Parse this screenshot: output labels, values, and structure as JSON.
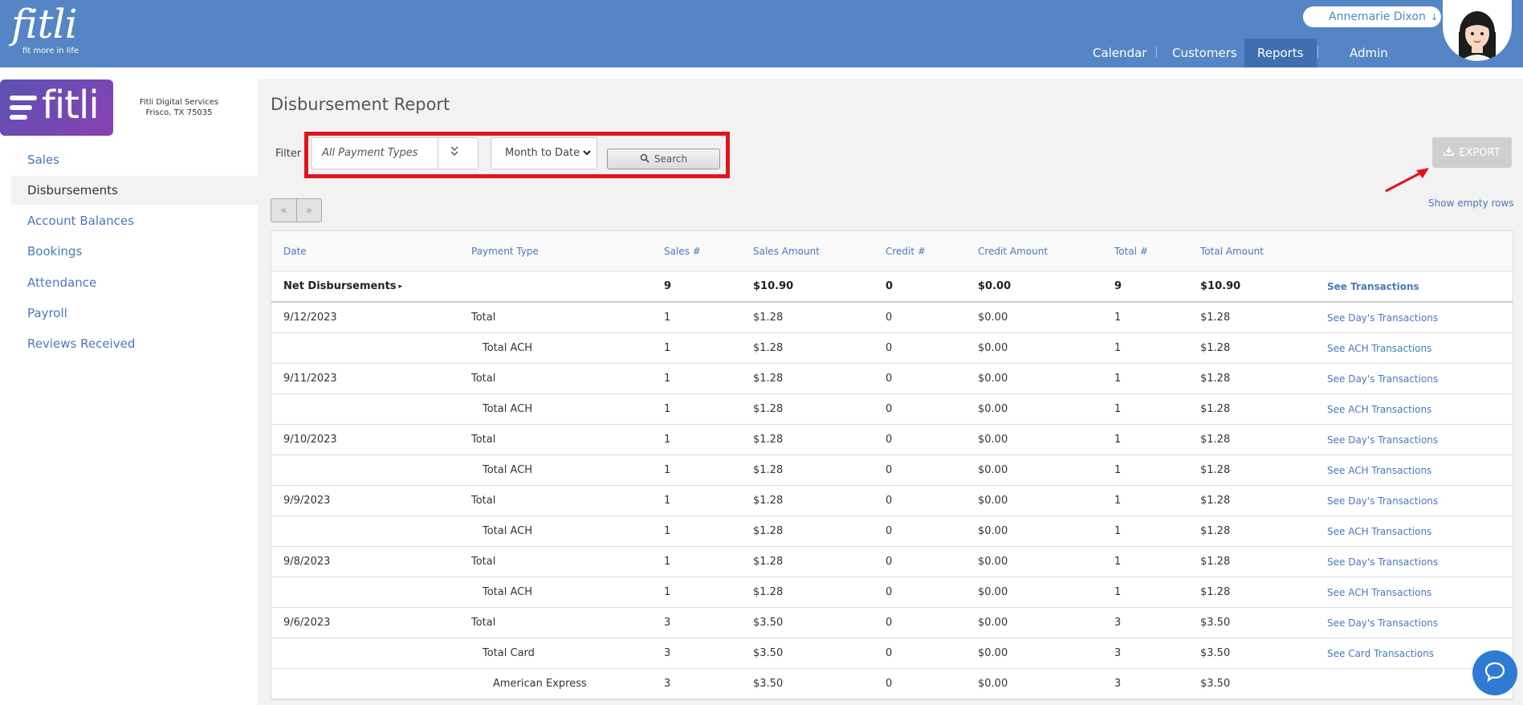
{
  "header": {
    "logo_word": "fitli",
    "logo_tagline": "fit more in life",
    "user_name": "Annemarie Dixon",
    "nav": [
      "Calendar",
      "Customers",
      "Reports",
      "Admin"
    ],
    "active_nav": "Reports"
  },
  "sidebar": {
    "brand_word": "fitli",
    "business_name": "Fitli Digital Services",
    "business_location": "Frisco, TX 75035",
    "items": [
      "Sales",
      "Disbursements",
      "Account Balances",
      "Bookings",
      "Attendance",
      "Payroll",
      "Reviews Received"
    ],
    "active_item": "Disbursements"
  },
  "main": {
    "title": "Disbursement Report",
    "filter_label": "Filter",
    "payment_type_value": "All Payment Types",
    "period_value": "Month to Date",
    "search_label": "Search",
    "export_label": "EXPORT",
    "pager_prev": "«",
    "pager_next": "»",
    "show_empty_rows": "Show empty rows"
  },
  "table": {
    "columns": [
      "Date",
      "Payment Type",
      "Sales #",
      "Sales Amount",
      "Credit #",
      "Credit Amount",
      "Total #",
      "Total Amount"
    ],
    "net": {
      "label": "Net Disbursements",
      "sales_count": "9",
      "sales_amount": "$10.90",
      "credit_count": "0",
      "credit_amount": "$0.00",
      "total_count": "9",
      "total_amount": "$10.90",
      "link": "See Transactions"
    },
    "rows": [
      {
        "date": "9/12/2023",
        "type": "Total",
        "level": 1,
        "sales": "1",
        "sales_amt": "$1.28",
        "credit": "0",
        "credit_amt": "$0.00",
        "total": "1",
        "total_amt": "$1.28",
        "link": "See Day's Transactions"
      },
      {
        "date": "",
        "type": "Total ACH",
        "level": 2,
        "sales": "1",
        "sales_amt": "$1.28",
        "credit": "0",
        "credit_amt": "$0.00",
        "total": "1",
        "total_amt": "$1.28",
        "link": "See ACH Transactions"
      },
      {
        "date": "9/11/2023",
        "type": "Total",
        "level": 1,
        "sales": "1",
        "sales_amt": "$1.28",
        "credit": "0",
        "credit_amt": "$0.00",
        "total": "1",
        "total_amt": "$1.28",
        "link": "See Day's Transactions"
      },
      {
        "date": "",
        "type": "Total ACH",
        "level": 2,
        "sales": "1",
        "sales_amt": "$1.28",
        "credit": "0",
        "credit_amt": "$0.00",
        "total": "1",
        "total_amt": "$1.28",
        "link": "See ACH Transactions"
      },
      {
        "date": "9/10/2023",
        "type": "Total",
        "level": 1,
        "sales": "1",
        "sales_amt": "$1.28",
        "credit": "0",
        "credit_amt": "$0.00",
        "total": "1",
        "total_amt": "$1.28",
        "link": "See Day's Transactions"
      },
      {
        "date": "",
        "type": "Total ACH",
        "level": 2,
        "sales": "1",
        "sales_amt": "$1.28",
        "credit": "0",
        "credit_amt": "$0.00",
        "total": "1",
        "total_amt": "$1.28",
        "link": "See ACH Transactions"
      },
      {
        "date": "9/9/2023",
        "type": "Total",
        "level": 1,
        "sales": "1",
        "sales_amt": "$1.28",
        "credit": "0",
        "credit_amt": "$0.00",
        "total": "1",
        "total_amt": "$1.28",
        "link": "See Day's Transactions"
      },
      {
        "date": "",
        "type": "Total ACH",
        "level": 2,
        "sales": "1",
        "sales_amt": "$1.28",
        "credit": "0",
        "credit_amt": "$0.00",
        "total": "1",
        "total_amt": "$1.28",
        "link": "See ACH Transactions"
      },
      {
        "date": "9/8/2023",
        "type": "Total",
        "level": 1,
        "sales": "1",
        "sales_amt": "$1.28",
        "credit": "0",
        "credit_amt": "$0.00",
        "total": "1",
        "total_amt": "$1.28",
        "link": "See Day's Transactions"
      },
      {
        "date": "",
        "type": "Total ACH",
        "level": 2,
        "sales": "1",
        "sales_amt": "$1.28",
        "credit": "0",
        "credit_amt": "$0.00",
        "total": "1",
        "total_amt": "$1.28",
        "link": "See ACH Transactions"
      },
      {
        "date": "9/6/2023",
        "type": "Total",
        "level": 1,
        "sales": "3",
        "sales_amt": "$3.50",
        "credit": "0",
        "credit_amt": "$0.00",
        "total": "3",
        "total_amt": "$3.50",
        "link": "See Day's Transactions"
      },
      {
        "date": "",
        "type": "Total Card",
        "level": 2,
        "sales": "3",
        "sales_amt": "$3.50",
        "credit": "0",
        "credit_amt": "$0.00",
        "total": "3",
        "total_amt": "$3.50",
        "link": "See Card Transactions"
      },
      {
        "date": "",
        "type": "American Express",
        "level": 3,
        "sales": "3",
        "sales_amt": "$3.50",
        "credit": "0",
        "credit_amt": "$0.00",
        "total": "3",
        "total_amt": "$3.50",
        "link": ""
      }
    ]
  },
  "colors": {
    "topbar": "#5585c4",
    "active_nav": "#3f6fae",
    "link": "#4a78bd",
    "highlight": "#e0141e",
    "chat": "#2f7bd3"
  },
  "icons": [
    "search-icon",
    "download-icon",
    "double-chevron-down-icon",
    "chevron-down-icon",
    "chat-icon",
    "red-arrow-annotation"
  ]
}
